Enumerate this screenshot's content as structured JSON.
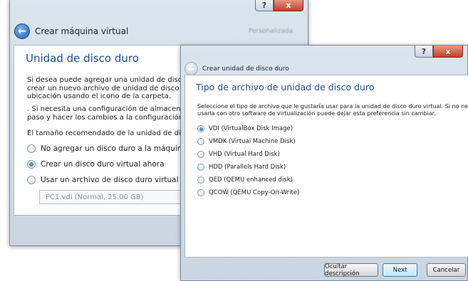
{
  "back_window": {
    "header_title": "Crear máquina virtual",
    "header_blur_text": "Personalizada",
    "page_title": "Unidad de disco duro",
    "description_lines": [
      "Si desea puede agregar una unidad de disco duro",
      "crear un nuevo archivo de unidad de disco duro o",
      "ubicación usando el icono de la carpeta.",
      ". Si necesita una configuración de almacenamiento",
      "paso y hacer los cambios a la configuración de la r",
      "El tamaño recomendado de la unidad de disco dur"
    ],
    "options": [
      {
        "label": "No agregar un disco duro a la máquina virtual",
        "selected": false
      },
      {
        "label": "Crear un disco duro virtual ahora",
        "selected": true
      },
      {
        "label": "Usar un archivo de disco duro virtual existente",
        "selected": false
      }
    ],
    "combo_value": "PC1.vdi (Normal, 25.00 GB)"
  },
  "front_window": {
    "header_title": "Crear unidad de disco duro",
    "page_title": "Tipo de archivo de unidad de disco duro",
    "description_lines": [
      "Seleccione el tipo de archivo que le gustaría usar para la unidad de disco duro virtual. Si no necesita",
      "usarla con otro software de virtualización puede dejar esta preferencia sin cambiar."
    ],
    "options": [
      {
        "label": "VDI (VirtualBox Disk Image)",
        "selected": true
      },
      {
        "label": "VMDK (Virtual Machine Disk)",
        "selected": false
      },
      {
        "label": "VHD (Virtual Hard Disk)",
        "selected": false
      },
      {
        "label": "HDD (Parallels Hard Disk)",
        "selected": false
      },
      {
        "label": "QED (QEMU enhanced disk)",
        "selected": false
      },
      {
        "label": "QCOW (QEMU Copy-On-Write)",
        "selected": false
      }
    ],
    "buttons": {
      "hide_description": "Ocultar descripción",
      "next": "Next",
      "cancel": "Cancelar"
    }
  },
  "caption": {
    "help_glyph": "?",
    "close_glyph": "x"
  },
  "colors": {
    "title_blue": "#1e4e96",
    "glass": "#c9d6e2",
    "close_red": "#c0402a"
  },
  "icons": {
    "back": "back-arrow-icon",
    "help": "help-icon",
    "close": "close-icon"
  }
}
